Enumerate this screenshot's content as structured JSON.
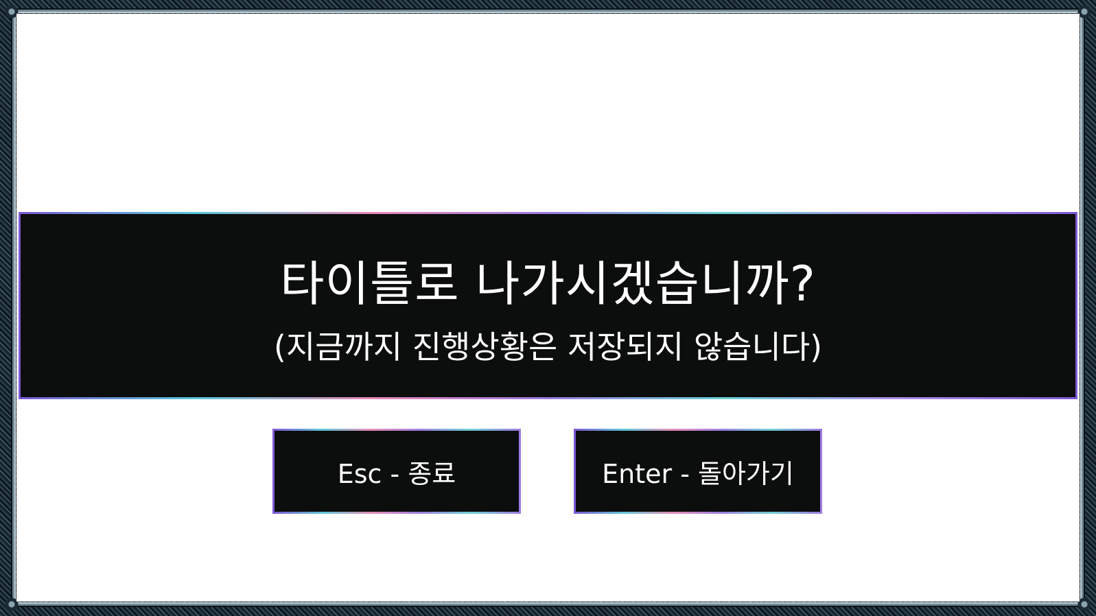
{
  "dialog": {
    "title": "타이틀로 나가시겠습니까?",
    "subtitle": "(지금까지 진행상황은 저장되지 않습니다)"
  },
  "buttons": {
    "quit_label": "Esc - 종료",
    "return_label": "Enter - 돌아가기"
  },
  "colors": {
    "panel": "#0c0d0d",
    "background": "#ffffff",
    "text": "#ffffff",
    "border_accents": [
      "#7c5bd6",
      "#58c7d8",
      "#e989b8"
    ]
  }
}
